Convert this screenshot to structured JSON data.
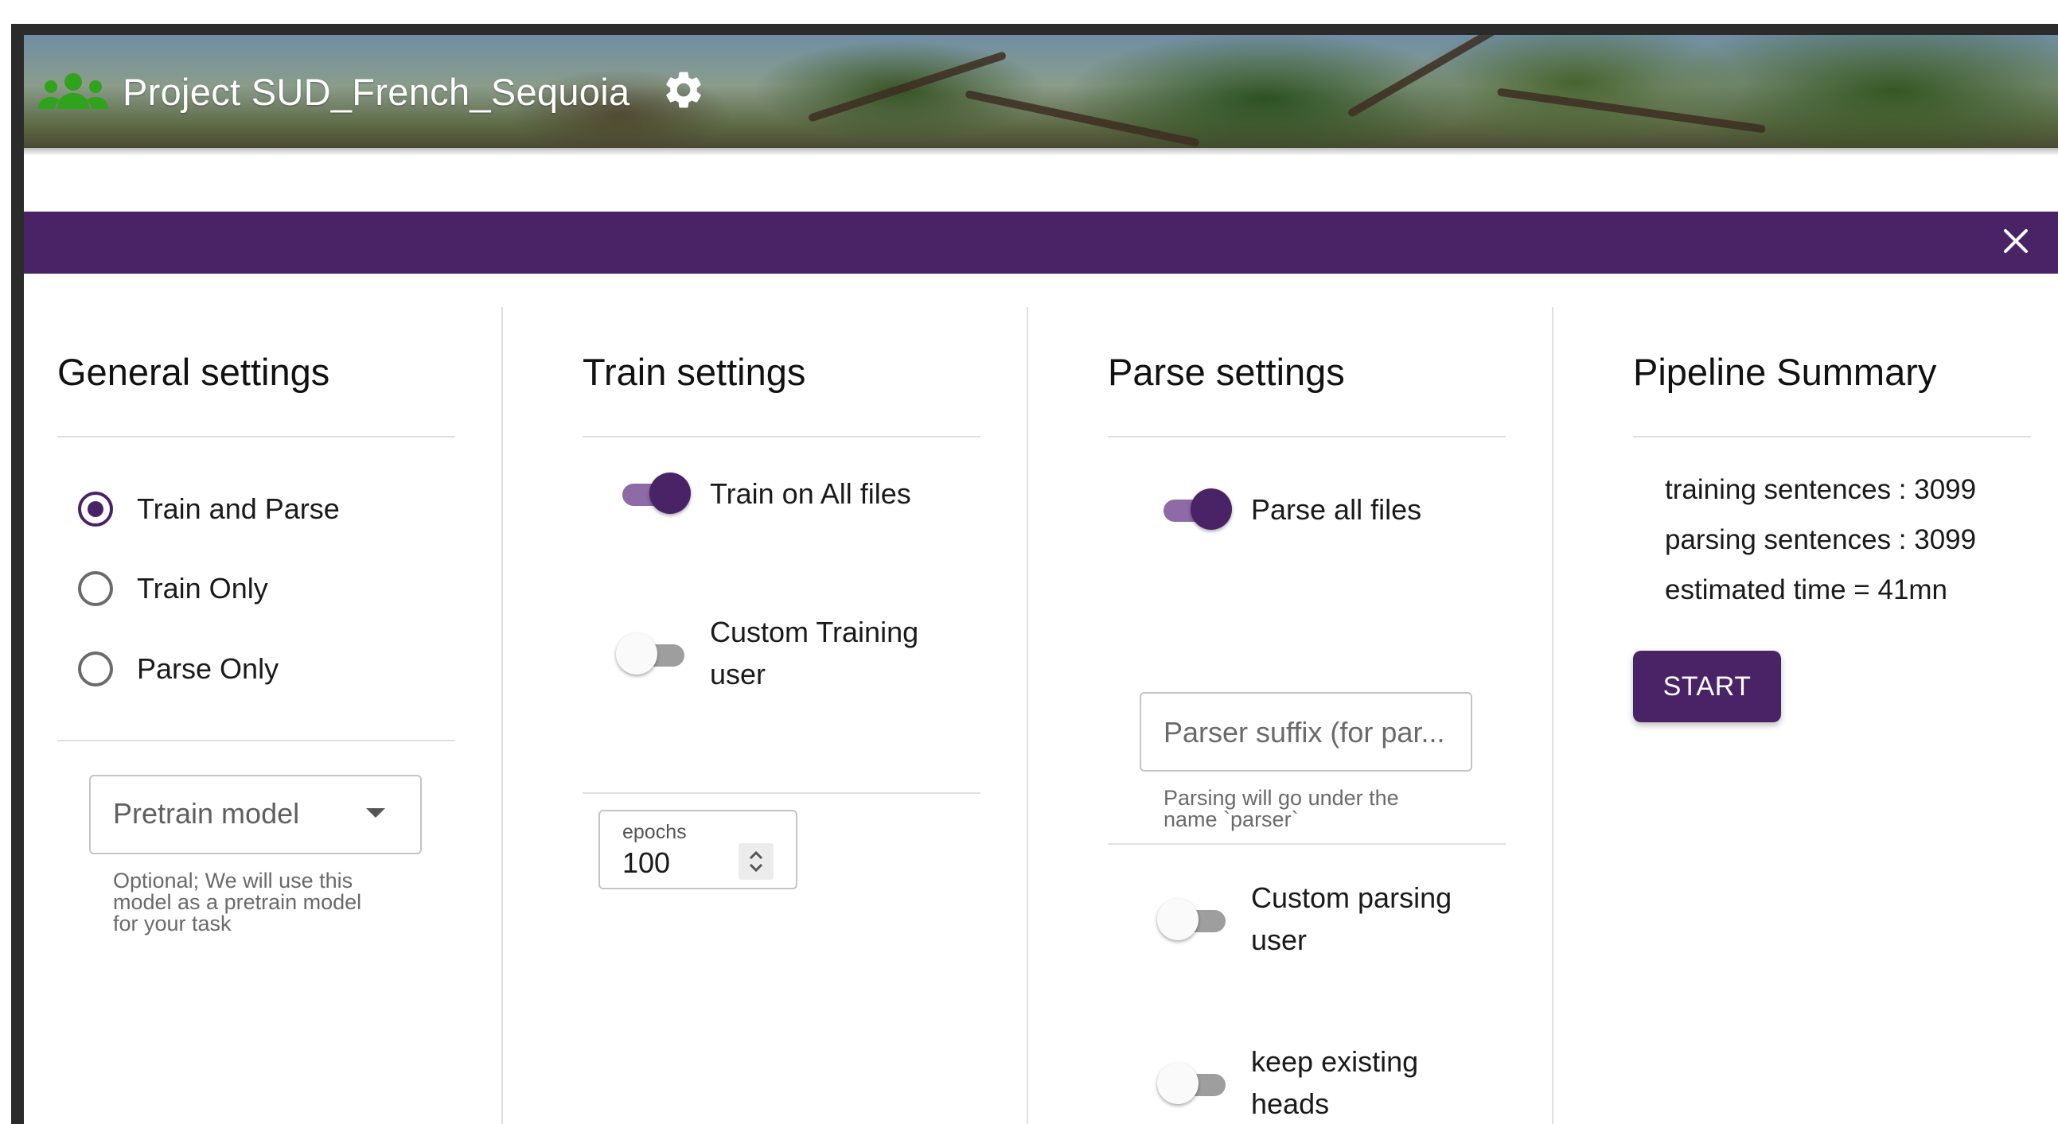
{
  "header": {
    "project_title": "Project SUD_French_Sequoia",
    "icons": {
      "project": "group-icon",
      "settings": "gear-icon"
    },
    "brand_color": "#2fa31c"
  },
  "dialog": {
    "accent_color": "#4a2366",
    "close_icon": "close-icon",
    "general": {
      "title": "General settings",
      "modes": [
        {
          "label": "Train and Parse",
          "selected": true
        },
        {
          "label": "Train Only",
          "selected": false
        },
        {
          "label": "Parse Only",
          "selected": false
        }
      ],
      "pretrain_select": {
        "value": "Pretrain model"
      },
      "pretrain_hint": [
        "Optional; We will use this",
        "model as a pretrain model",
        "for your task"
      ]
    },
    "train": {
      "title": "Train settings",
      "train_all": {
        "label": "Train on All files",
        "on": true
      },
      "custom_training": {
        "label_line1": "Custom Training",
        "label_line2": "user",
        "on": false
      },
      "epochs": {
        "label": "epochs",
        "value": "100"
      }
    },
    "parse": {
      "title": "Parse settings",
      "parse_all": {
        "label": "Parse all files",
        "on": true
      },
      "suffix_input": {
        "placeholder": "Parser suffix (for par..."
      },
      "suffix_hint": [
        "Parsing will go under the",
        "name `parser`"
      ],
      "custom_parsing": {
        "label_line1": "Custom parsing",
        "label_line2": "user",
        "on": false
      },
      "keep_heads": {
        "label_line1": "keep existing",
        "label_line2": "heads",
        "on": false
      }
    },
    "summary": {
      "title": "Pipeline Summary",
      "training_sentences": "training sentences : 3099",
      "parsing_sentences": "parsing sentences : 3099",
      "estimated_time": "estimated time = 41mn",
      "start_label": "START"
    }
  }
}
